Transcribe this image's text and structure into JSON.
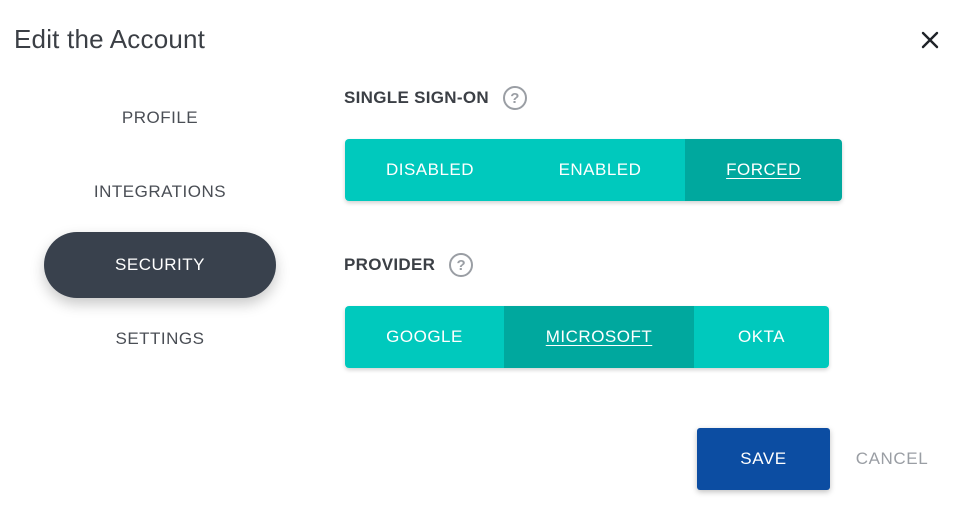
{
  "dialog": {
    "title": "Edit the Account",
    "close_icon": "close-icon"
  },
  "nav": {
    "items": [
      {
        "label": "PROFILE",
        "active": false
      },
      {
        "label": "INTEGRATIONS",
        "active": false
      },
      {
        "label": "SECURITY",
        "active": true
      },
      {
        "label": "SETTINGS",
        "active": false
      }
    ]
  },
  "sso": {
    "label": "SINGLE SIGN-ON",
    "help_icon": "help-icon",
    "options": [
      "DISABLED",
      "ENABLED",
      "FORCED"
    ],
    "selected": "FORCED"
  },
  "provider": {
    "label": "PROVIDER",
    "help_icon": "help-icon",
    "options": [
      "GOOGLE",
      "MICROSOFT",
      "OKTA"
    ],
    "selected": "MICROSOFT"
  },
  "actions": {
    "save_label": "SAVE",
    "cancel_label": "CANCEL"
  },
  "colors": {
    "segment": "#00c9bd",
    "segment_selected": "#00a89e",
    "nav_active": "#39414d",
    "save": "#0c4da2"
  }
}
